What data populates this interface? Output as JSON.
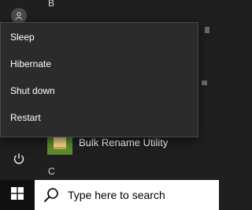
{
  "start_menu": {
    "power_flyout": {
      "items": [
        {
          "label": "Sleep"
        },
        {
          "label": "Hibernate"
        },
        {
          "label": "Shut down"
        },
        {
          "label": "Restart"
        }
      ]
    },
    "app_list": {
      "section_letters": [
        "B",
        "C"
      ],
      "apps": [
        {
          "label": "Bulk Rename Utility",
          "icon": "bulk-rename-utility-icon"
        }
      ]
    },
    "rail": {
      "user_icon": "user-avatar-icon",
      "power_icon": "power-icon"
    }
  },
  "taskbar": {
    "start_icon": "windows-logo-icon",
    "search": {
      "placeholder": "Type here to search",
      "icon": "search-icon"
    }
  },
  "colors": {
    "menu_background": "#1f1f1f",
    "flyout_background": "#2b2b2b",
    "taskbar_background": "#101010",
    "search_background": "#ffffff"
  }
}
